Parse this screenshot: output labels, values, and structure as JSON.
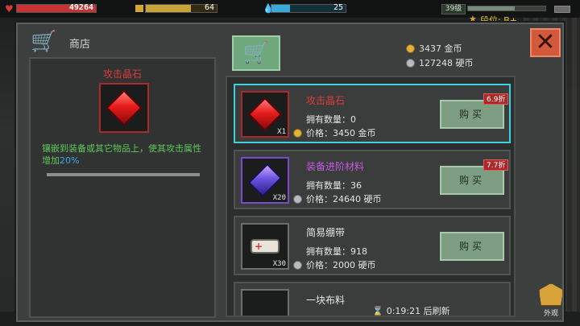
{
  "hud": {
    "hp_value": "49264",
    "hp_fill": 1.0,
    "food_value": "64",
    "food_fill": 0.64,
    "water_value": "25",
    "water_fill": 0.25,
    "level": "39级",
    "xp_fill": 0.6,
    "rank_label": "段位: B+"
  },
  "shop": {
    "title": "商店",
    "currency": {
      "gold_amount": "3437",
      "gold_unit": "金币",
      "silver_amount": "127248",
      "silver_unit": "硬币"
    },
    "detail": {
      "name": "攻击晶石",
      "description_main": "镶嵌到装备或其它物品上，使其攻击属性增加",
      "description_value": "20%"
    },
    "items": [
      {
        "name": "攻击晶石",
        "name_color": "#e03a3a",
        "thumb_badge": "X1",
        "owned": "拥有数量：0",
        "price": "价格：3450 金币",
        "price_coin": "gold",
        "buy_label": "购买",
        "discount": "6.9折",
        "selected": true
      },
      {
        "name": "装备进阶材料",
        "name_color": "#c55ae0",
        "thumb_badge": "X20",
        "owned": "拥有数量：36",
        "price": "价格：24640 硬币",
        "price_coin": "silver",
        "buy_label": "购买",
        "discount": "7.7折",
        "selected": false
      },
      {
        "name": "简易绷带",
        "name_color": "#e6e6e6",
        "thumb_badge": "X30",
        "owned": "拥有数量：918",
        "price": "价格：2000 硬币",
        "price_coin": "silver",
        "buy_label": "购买",
        "discount": "",
        "selected": false
      },
      {
        "name": "一块布料",
        "name_color": "#e6e6e6"
      }
    ],
    "refresh_time": "0:19:21",
    "refresh_suffix": "后刷新"
  },
  "outfit_label": "外观",
  "colors": {
    "accent_cyan": "#3fd0e0",
    "close_red": "#d25a3a",
    "buy_green": "#7d9e82"
  }
}
